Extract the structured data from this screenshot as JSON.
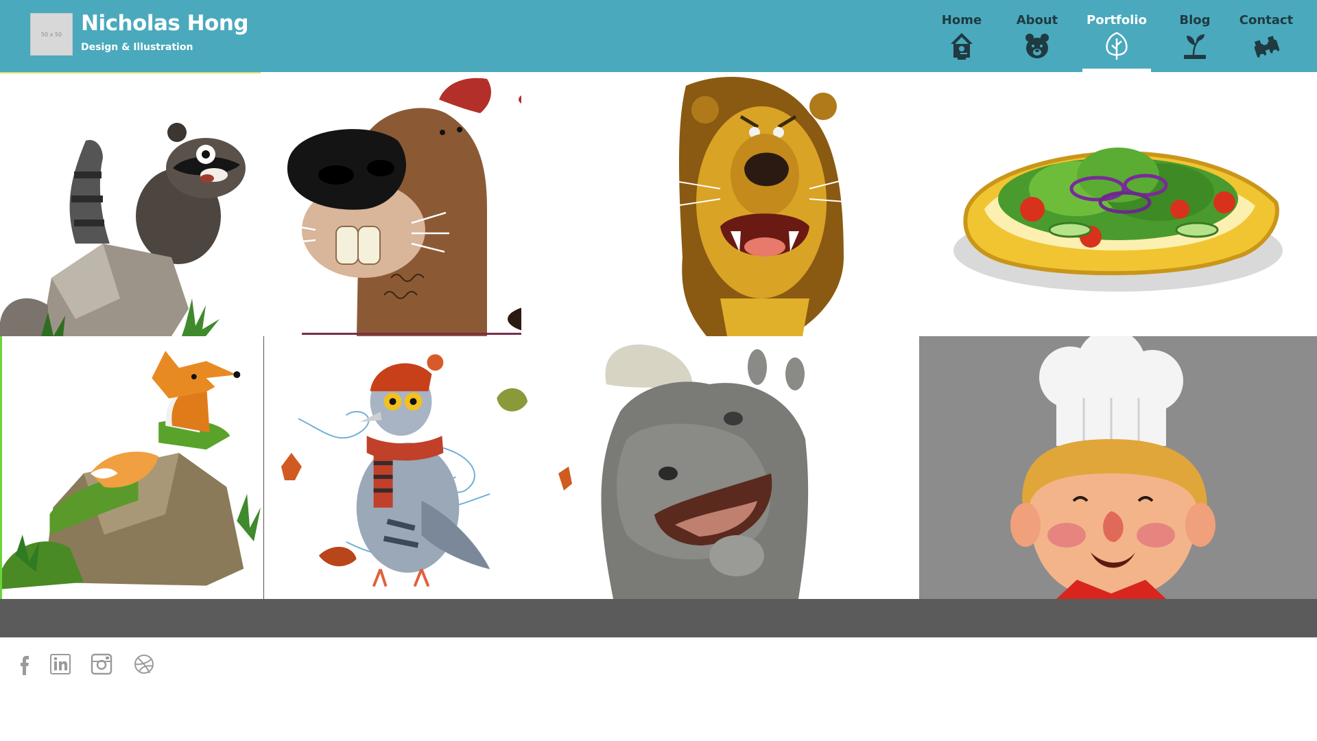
{
  "header": {
    "logo_placeholder": "50 x 50",
    "brand_name": "Nicholas Hong",
    "brand_tagline": "Design & Illustration",
    "background_color": "#4aa9bd",
    "active_nav_text_color": "#ffffff",
    "nav_text_color": "#1f3a40"
  },
  "nav": [
    {
      "label": "Home",
      "icon": "birdhouse-icon"
    },
    {
      "label": "About",
      "icon": "bear-icon"
    },
    {
      "label": "Portfolio",
      "icon": "tree-icon",
      "active": true
    },
    {
      "label": "Blog",
      "icon": "sprout-icon"
    },
    {
      "label": "Contact",
      "icon": "binoculars-icon"
    }
  ],
  "portfolio": [
    {
      "subject": "raccoon-on-rock"
    },
    {
      "subject": "beaver"
    },
    {
      "subject": "lion"
    },
    {
      "subject": "salad-plate"
    },
    {
      "subject": "fox-on-rock"
    },
    {
      "subject": "pigeon-in-hat-and-scarf"
    },
    {
      "subject": "rhino"
    },
    {
      "subject": "chef-boy"
    }
  ],
  "footer": {
    "band_color": "#5b5b5b",
    "social": [
      "facebook-icon",
      "linkedin-icon",
      "instagram-icon",
      "dribbble-icon"
    ]
  }
}
